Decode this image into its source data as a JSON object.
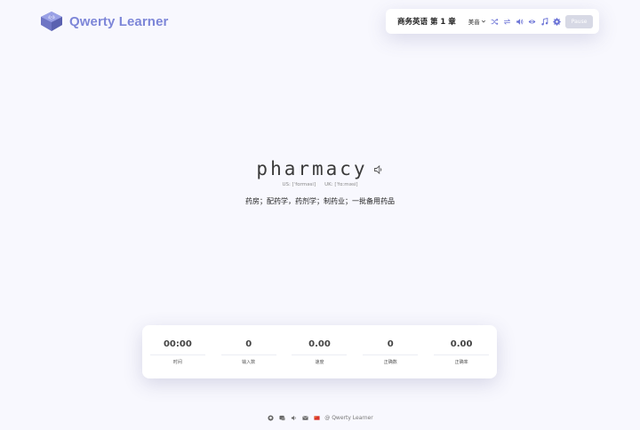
{
  "app": {
    "name": "Qwerty Learner"
  },
  "toolbar": {
    "dictionary_chapter": "商务英语 第 1 章",
    "accent_label": "美音",
    "pause_label": "Pause"
  },
  "word": {
    "text": "pharmacy",
    "phonetic_us": "US: [ˈfɑrməsi]",
    "phonetic_uk": "UK: [ˈfɑːməsi]",
    "translation": "药房；配药学，药剂学；制药业；一批备用药品"
  },
  "stats": [
    {
      "value": "00:00",
      "label": "时间"
    },
    {
      "value": "0",
      "label": "输入数"
    },
    {
      "value": "0.00",
      "label": "速度"
    },
    {
      "value": "0",
      "label": "正确数"
    },
    {
      "value": "0.00",
      "label": "正确率"
    }
  ],
  "footer": {
    "copyright": "@ Qwerty Learner"
  },
  "colors": {
    "brand": "#7d86d8",
    "icon": "#6b73d6",
    "background": "#f8f8fe"
  }
}
